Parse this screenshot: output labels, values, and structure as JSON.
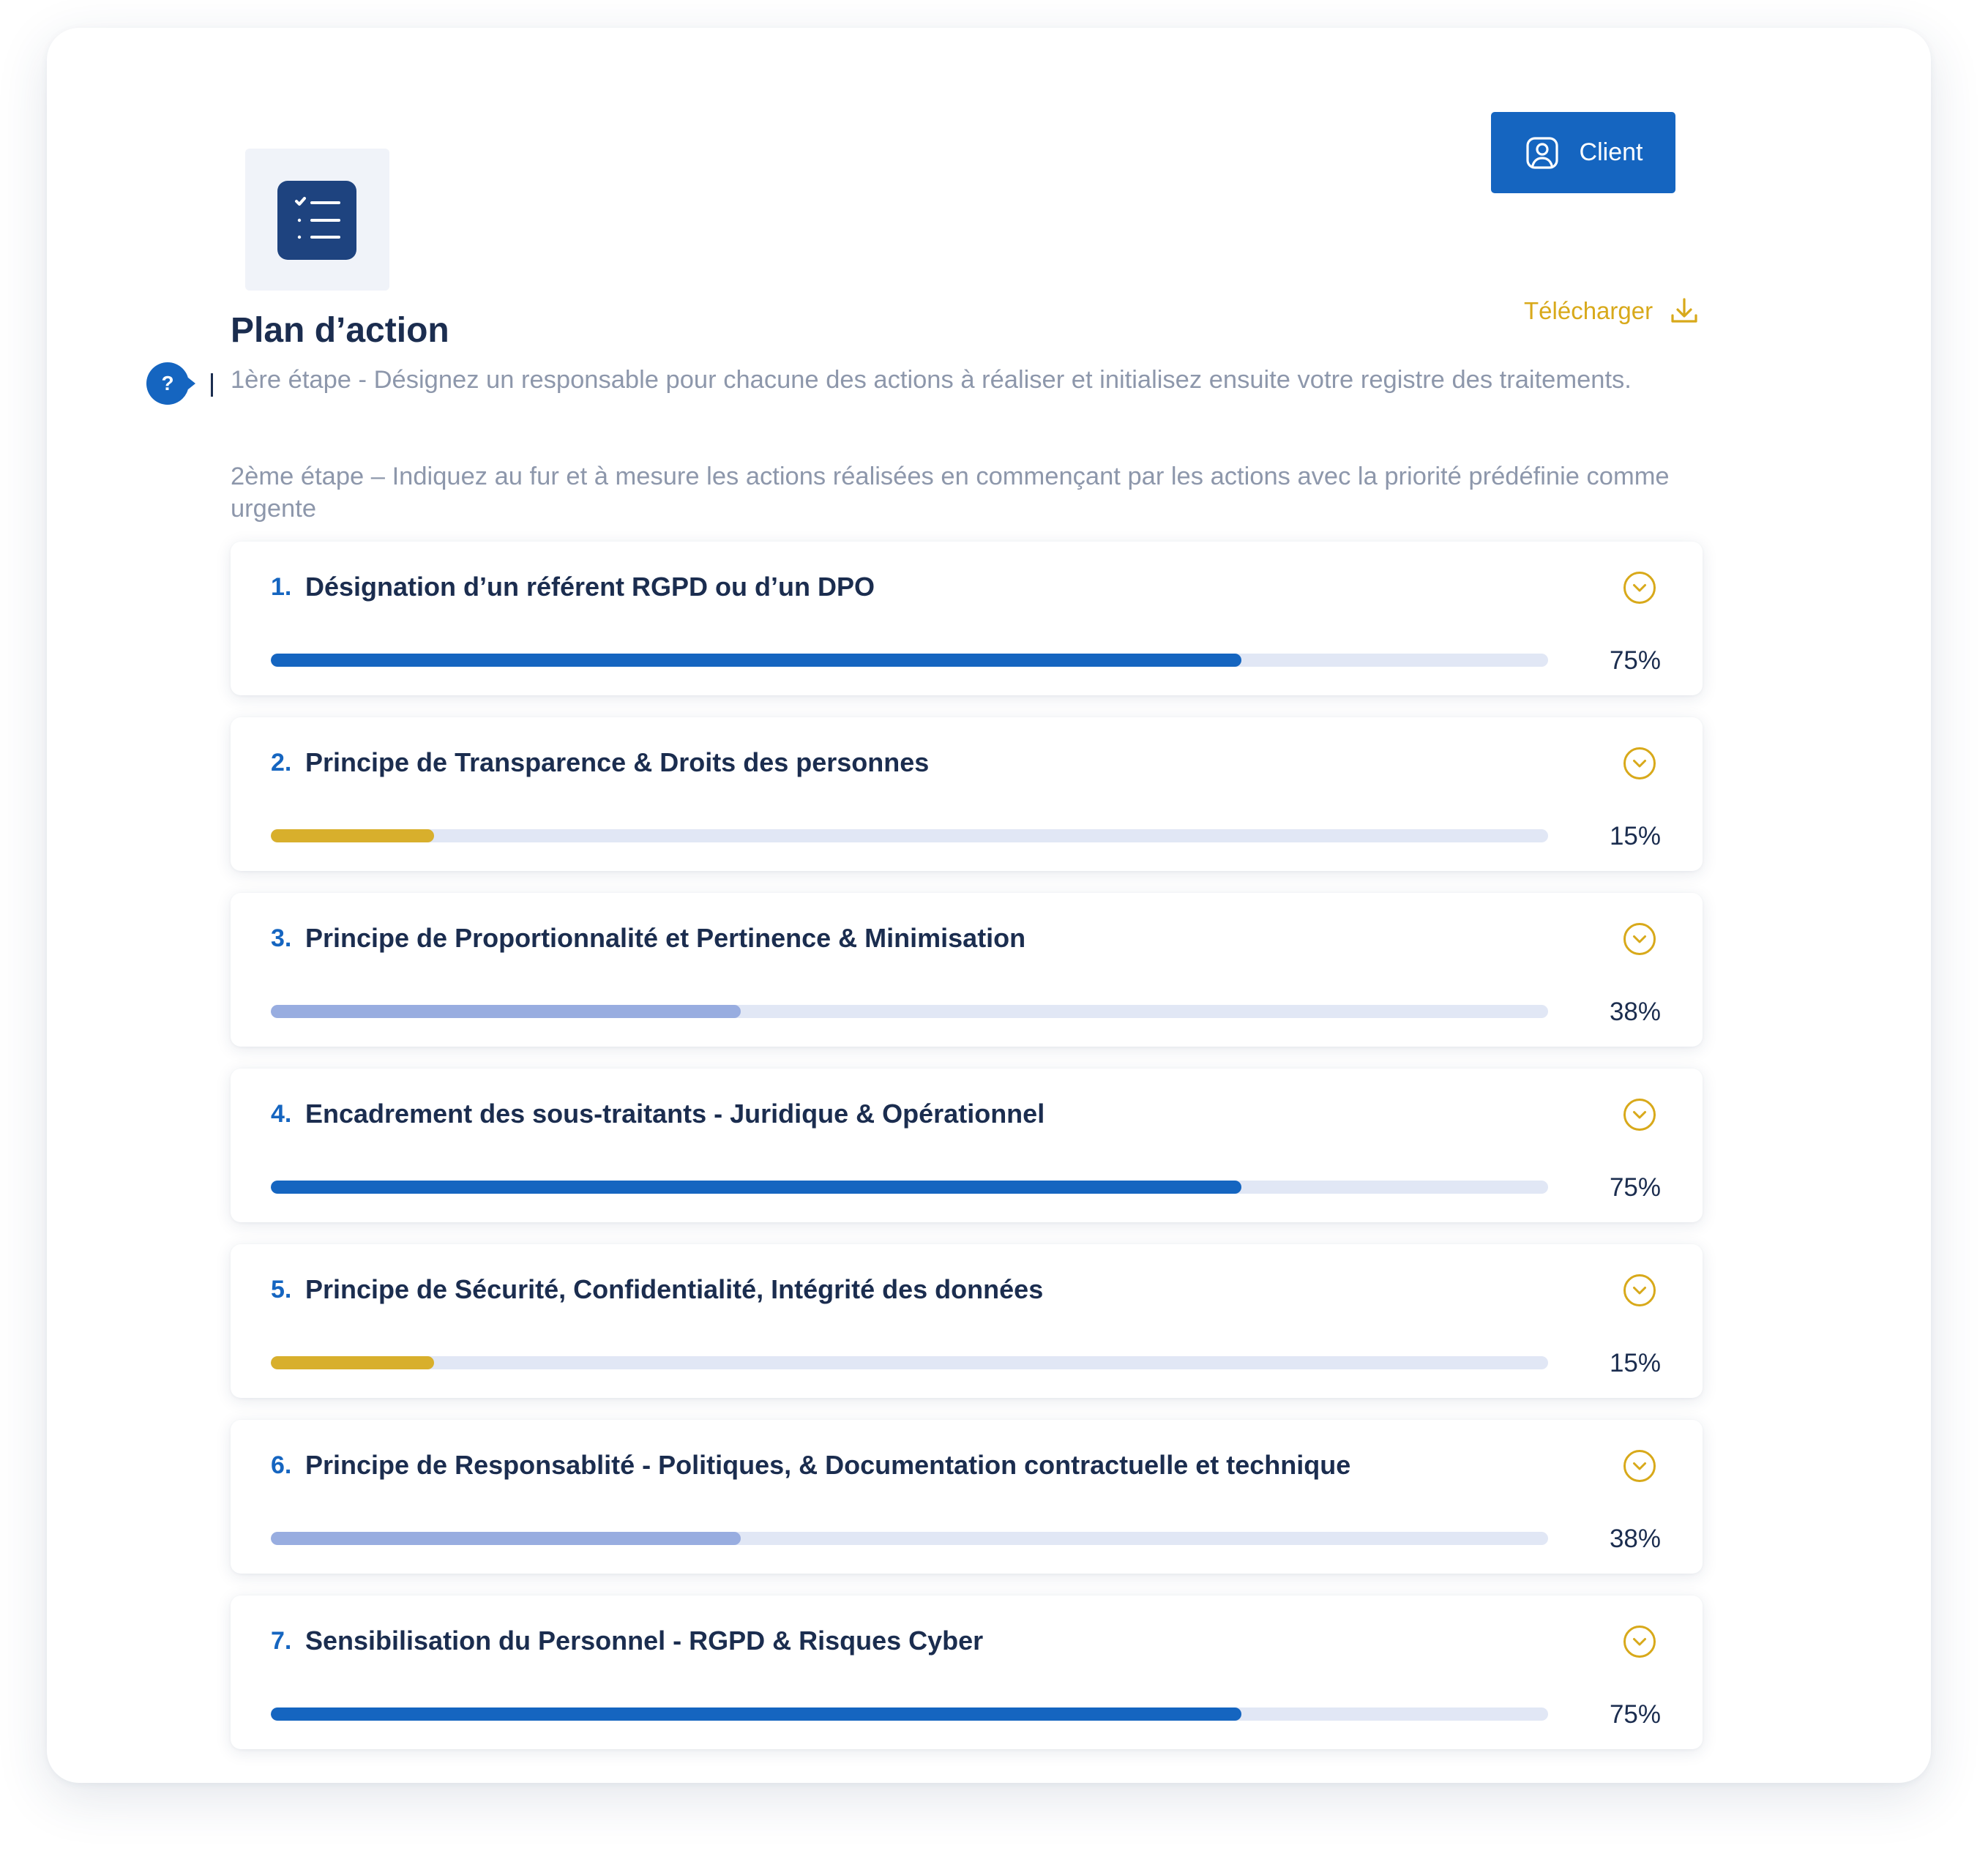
{
  "header": {
    "client_label": "Client",
    "download_label": "Télécharger",
    "title": "Plan d’action",
    "help_label": "?",
    "step1": "1ère étape - Désignez un responsable pour chacune des actions à réaliser et initialisez ensuite votre registre des traitements.",
    "step2": "2ème étape – Indiquez au fur et à mesure les actions réalisées en commençant par les actions avec la priorité prédéfinie comme urgente"
  },
  "colors": {
    "primary": "#1565c0",
    "accent_gold": "#d8a91a",
    "track": "#e1e7f5",
    "bar_high": "#1565c0",
    "bar_low": "#d8af2c",
    "bar_mid": "#98ade0"
  },
  "actions": [
    {
      "number": "1.",
      "title": "Désignation d’un référent RGPD ou d’un DPO",
      "percent_label": "75%",
      "progress": 0.76,
      "color": "#1565c0"
    },
    {
      "number": "2.",
      "title": "Principe de Transparence &  Droits des personnes",
      "percent_label": "15%",
      "progress": 0.128,
      "color": "#d8af2c"
    },
    {
      "number": "3.",
      "title": "Principe de Proportionnalité et Pertinence & Minimisation",
      "percent_label": "38%",
      "progress": 0.368,
      "color": "#98ade0"
    },
    {
      "number": "4.",
      "title": "Encadrement des sous-traitants - Juridique & Opérationnel",
      "percent_label": "75%",
      "progress": 0.76,
      "color": "#1565c0"
    },
    {
      "number": "5.",
      "title": "Principe de Sécurité, Confidentialité, Intégrité des données",
      "percent_label": "15%",
      "progress": 0.128,
      "color": "#d8af2c"
    },
    {
      "number": "6.",
      "title": "Principe de Responsablité - Politiques, & Documentation contractuelle et technique",
      "percent_label": "38%",
      "progress": 0.368,
      "color": "#98ade0"
    },
    {
      "number": "7.",
      "title": "Sensibilisation du Personnel - RGPD & Risques Cyber",
      "percent_label": "75%",
      "progress": 0.76,
      "color": "#1565c0"
    }
  ],
  "icons": {
    "client": "user-profile-icon",
    "download": "download-icon",
    "logo": "checklist-icon",
    "expand": "chevron-down-circle-icon"
  }
}
